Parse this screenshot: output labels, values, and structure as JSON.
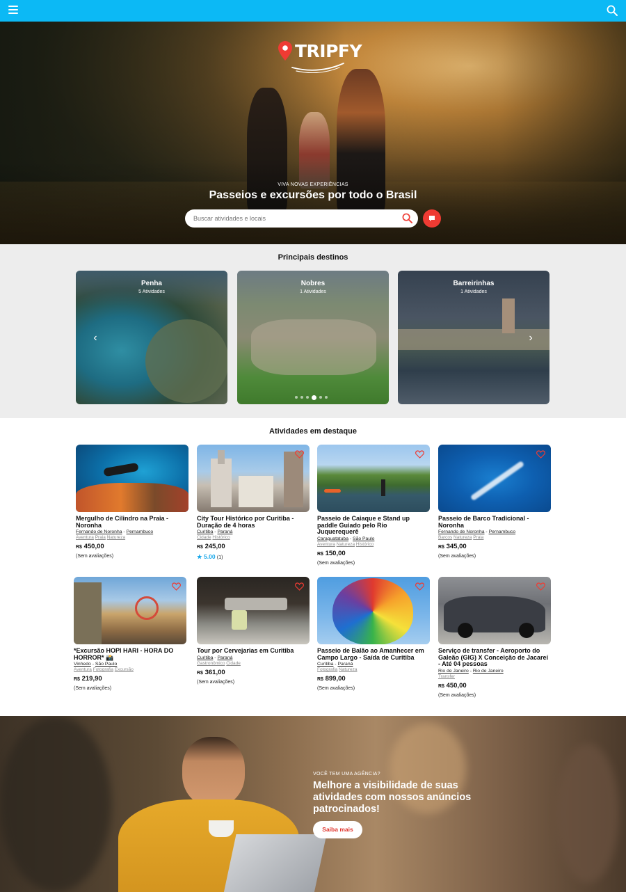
{
  "topbar": {
    "menu_icon": "hamburger-icon",
    "search_icon": "search-icon",
    "color": "#0cb9f5"
  },
  "hero": {
    "logo": "TRIPFY",
    "eyebrow": "VIVA NOVAS EXPERIÊNCIAS",
    "title": "Passeios e excursões por todo o Brasil",
    "search_placeholder": "Buscar atividades e locais",
    "chat_icon": "chat-icon"
  },
  "destinations": {
    "title": "Principais destinos",
    "items": [
      {
        "name": "Penha",
        "count": "5 Atividades"
      },
      {
        "name": "Nobres",
        "count": "1 Atividades"
      },
      {
        "name": "Barreirinhas",
        "count": "1 Atividades"
      }
    ],
    "pager": {
      "total": 6,
      "active": 4
    }
  },
  "activities": {
    "title": "Atividades em destaque",
    "items": [
      {
        "name": "Mergulho de Cilindro na Praia - Noronha",
        "city": "Fernando de Noronha",
        "state": "Pernambuco",
        "tags": [
          "Aventura",
          "Praia",
          "Natureza"
        ],
        "currency": "R$",
        "price": "450,00",
        "reviews": "(Sem avaliações)"
      },
      {
        "name": "City Tour Histórico por Curitiba - Duração de 4 horas",
        "city": "Curitiba",
        "state": "Paraná",
        "tags": [
          "Cidade",
          "Histórico"
        ],
        "currency": "R$",
        "price": "245,00",
        "rating": "5.00",
        "rating_count": "(1)"
      },
      {
        "name": "Passeio de Caiaque e Stand up paddle Guiado pelo Rio Juquerequerê",
        "city": "Caraguatatuba",
        "state": "São Paulo",
        "tags": [
          "Aventura",
          "Natureza",
          "Histórico"
        ],
        "currency": "R$",
        "price": "150,00",
        "reviews": "(Sem avaliações)"
      },
      {
        "name": "Passeio de Barco Tradicional - Noronha",
        "city": "Fernando de Noronha",
        "state": "Pernambuco",
        "tags": [
          "Barcos",
          "Natureza",
          "Praia"
        ],
        "currency": "R$",
        "price": "345,00",
        "reviews": "(Sem avaliações)"
      },
      {
        "name": "*Excursão HOPI HARI - HORA DO HORROR* 📸",
        "city": "Vinhedo",
        "state": "São Paulo",
        "tags": [
          "Aventura",
          "Fotografia",
          "Excursão"
        ],
        "currency": "R$",
        "price": "219,90",
        "reviews": "(Sem avaliações)"
      },
      {
        "name": "Tour por Cervejarias em Curitiba",
        "city": "Curitiba",
        "state": "Paraná",
        "tags": [
          "Gastronômico",
          "Cidade"
        ],
        "currency": "R$",
        "price": "361,00",
        "reviews": "(Sem avaliações)"
      },
      {
        "name": "Passeio de Balão ao Amanhecer em Campo Largo - Saída de Curitiba",
        "city": "Curitiba",
        "state": "Paraná",
        "tags": [
          "Fotografia",
          "Natureza"
        ],
        "currency": "R$",
        "price": "899,00",
        "reviews": "(Sem avaliações)"
      },
      {
        "name": "Serviço de transfer - Aeroporto do Galeão (GIG) X Conceição de Jacareí - Até 04 pessoas",
        "city": "Rio de Janeiro",
        "state": "Rio de Janeiro",
        "tags": [
          "Transfer"
        ],
        "currency": "R$",
        "price": "450,00",
        "reviews": "(Sem avaliações)"
      }
    ]
  },
  "promo": {
    "eyebrow": "VOCÊ TEM UMA AGÊNCIA?",
    "heading": "Melhore a visibilidade de suas atividades com nossos anúncios patrocinados!",
    "button": "Saiba mais"
  },
  "colors": {
    "accent": "#0cb9f5",
    "brand_red": "#ef3b33",
    "star": "#1aa8ea"
  }
}
